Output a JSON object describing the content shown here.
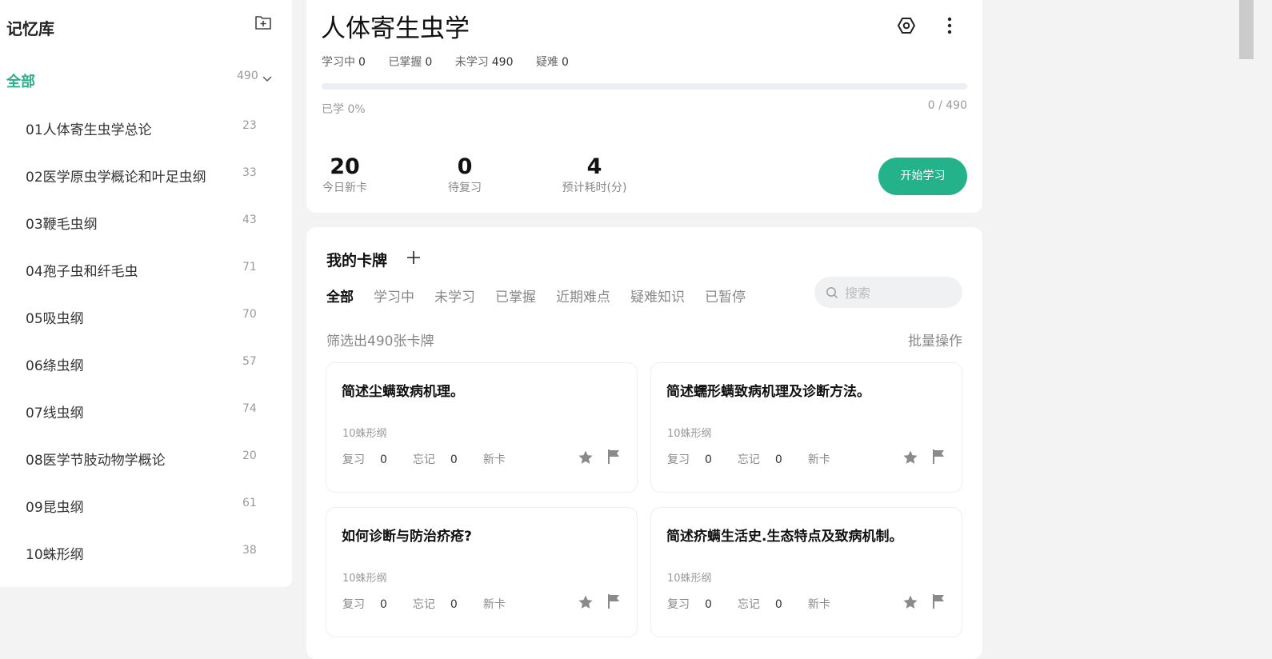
{
  "sidebar": {
    "title": "记忆库",
    "all_label": "全部",
    "all_count": "490",
    "items": [
      {
        "label": "01人体寄生虫学总论",
        "count": "23"
      },
      {
        "label": "02医学原虫学概论和叶足虫纲",
        "count": "33"
      },
      {
        "label": "03鞭毛虫纲",
        "count": "43"
      },
      {
        "label": "04孢子虫和纤毛虫",
        "count": "71"
      },
      {
        "label": "05吸虫纲",
        "count": "70"
      },
      {
        "label": "06绦虫纲",
        "count": "57"
      },
      {
        "label": "07线虫纲",
        "count": "74"
      },
      {
        "label": "08医学节肢动物学概论",
        "count": "20"
      },
      {
        "label": "09昆虫纲",
        "count": "61"
      },
      {
        "label": "10蛛形纲",
        "count": "38"
      }
    ]
  },
  "deck": {
    "title": "人体寄生虫学",
    "stats": [
      {
        "label": "学习中",
        "value": "0"
      },
      {
        "label": "已掌握",
        "value": "0"
      },
      {
        "label": "未学习",
        "value": "490"
      },
      {
        "label": "疑难",
        "value": "0"
      }
    ],
    "progress_fraction": 0,
    "learned_pct": "已学 0%",
    "learned_ratio": "0 / 490",
    "metrics": [
      {
        "value": "20",
        "label": "今日新卡"
      },
      {
        "value": "0",
        "label": "待复习"
      },
      {
        "value": "4",
        "label": "预计耗时(分)"
      }
    ],
    "start_label": "开始学习"
  },
  "cards_panel": {
    "title": "我的卡牌",
    "tabs": [
      "全部",
      "学习中",
      "未学习",
      "已掌握",
      "近期难点",
      "疑难知识",
      "已暂停"
    ],
    "search_placeholder": "搜索",
    "filter_count": "筛选出490张卡牌",
    "batch_label": "批量操作",
    "cards": [
      {
        "question": "简述尘螨致病机理。",
        "category": "10蛛形纲",
        "review_label": "复习",
        "review": "0",
        "forget_label": "忘记",
        "forget": "0",
        "status": "新卡"
      },
      {
        "question": "简述蠕形螨致病机理及诊断方法。",
        "category": "10蛛形纲",
        "review_label": "复习",
        "review": "0",
        "forget_label": "忘记",
        "forget": "0",
        "status": "新卡"
      },
      {
        "question": "如何诊断与防治疥疮?",
        "category": "10蛛形纲",
        "review_label": "复习",
        "review": "0",
        "forget_label": "忘记",
        "forget": "0",
        "status": "新卡"
      },
      {
        "question": "简述疥螨生活史.生态特点及致病机制。",
        "category": "10蛛形纲",
        "review_label": "复习",
        "review": "0",
        "forget_label": "忘记",
        "forget": "0",
        "status": "新卡"
      }
    ]
  },
  "colors": {
    "accent": "#24b28b",
    "background": "#f3f3f3",
    "icon_gray": "#8a8a8a"
  }
}
